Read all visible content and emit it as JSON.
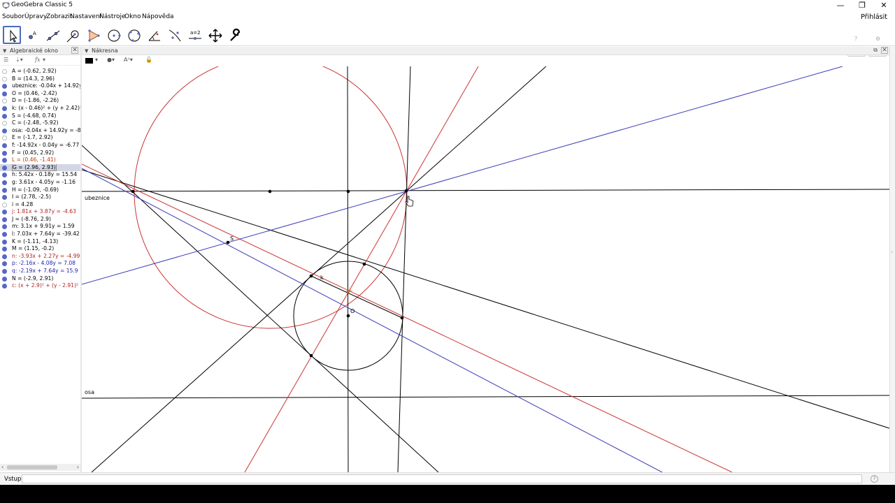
{
  "window": {
    "title": "GeoGebra Classic 5",
    "minimize": "—",
    "restore": "❐",
    "close": "✕"
  },
  "menu": [
    "Soubor",
    "Úpravy",
    "Zobrazit",
    "Nastavení",
    "Nástroje",
    "Okno",
    "Nápověda"
  ],
  "login": "Přihlásit",
  "toolbar": {
    "tools": [
      "move-tool",
      "point-tool",
      "line-tool",
      "perpendicular-tool",
      "polygon-tool",
      "circle-tool",
      "ellipse-tool",
      "angle-tool",
      "reflect-tool",
      "slider-tool",
      "move-graphics-tool",
      "settings-tool"
    ],
    "slider_text": "a=2",
    "undo": "↶",
    "redo": "↷",
    "help": "?",
    "settings": "⚙"
  },
  "algebra": {
    "title": "Algebraické okno",
    "close": "✕",
    "fx": "fx",
    "items": [
      {
        "text": "A = (-0.62, 2.92)",
        "visible": false,
        "color": "#000000"
      },
      {
        "text": "B = (14.3, 2.96)",
        "visible": false,
        "color": "#000000"
      },
      {
        "text": "ubeznice: -0.04x + 14.92y",
        "visible": true,
        "color": "#000000"
      },
      {
        "text": "O = (0.46, -2.42)",
        "visible": true,
        "color": "#000000"
      },
      {
        "text": "D = (-1.86, -2.26)",
        "visible": false,
        "color": "#000000"
      },
      {
        "text": "k: (x - 0.46)² + (y + 2.42)² =",
        "visible": true,
        "color": "#000000"
      },
      {
        "text": "S = (-4.68, 0.74)",
        "visible": true,
        "color": "#000000"
      },
      {
        "text": "C = (-2.48, -5.92)",
        "visible": false,
        "color": "#000000"
      },
      {
        "text": "osa: -0.04x + 14.92y = -88.",
        "visible": true,
        "color": "#000000"
      },
      {
        "text": "E = (-1.7, 2.92)",
        "visible": false,
        "color": "#000000"
      },
      {
        "text": "f: -14.92x - 0.04y = -6.77",
        "visible": true,
        "color": "#000000"
      },
      {
        "text": "F = (0.45, 2.92)",
        "visible": true,
        "color": "#000000"
      },
      {
        "text": "L = (0.46, -1.41)",
        "visible": true,
        "color": "#cc3300"
      },
      {
        "text": "G = (2.96, 2.93)",
        "visible": true,
        "color": "#000000",
        "selected": true
      },
      {
        "text": "h: 5.42x - 0.18y = 15.54",
        "visible": true,
        "color": "#000000"
      },
      {
        "text": "g: 3.61x - 4.05y = -1.16",
        "visible": true,
        "color": "#000000"
      },
      {
        "text": "H = (-1.09, -0.69)",
        "visible": true,
        "color": "#000000"
      },
      {
        "text": "I = (2.78, -2.5)",
        "visible": true,
        "color": "#000000"
      },
      {
        "text": "i = 4.28",
        "visible": false,
        "color": "#000000"
      },
      {
        "text": "j: 1.81x + 3.87y = -4.63",
        "visible": true,
        "color": "#b22222"
      },
      {
        "text": "J = (-8.76, 2.9)",
        "visible": true,
        "color": "#000000"
      },
      {
        "text": "m: 3.1x + 9.91y = 1.59",
        "visible": true,
        "color": "#000000"
      },
      {
        "text": "l: 7.03x + 7.64y = -39.42",
        "visible": true,
        "color": "#000000"
      },
      {
        "text": "K = (-1.11, -4.13)",
        "visible": true,
        "color": "#000000"
      },
      {
        "text": "M = (1.15, -0.2)",
        "visible": true,
        "color": "#000000"
      },
      {
        "text": "n: -3.93x + 2.27y = -4.99",
        "visible": true,
        "color": "#b22222"
      },
      {
        "text": "p: -2.16x - 4.08y = 7.08",
        "visible": true,
        "color": "#2222aa"
      },
      {
        "text": "q: -2.19x + 7.64y = 15.9",
        "visible": true,
        "color": "#2222aa"
      },
      {
        "text": "N = (-2.9, 2.91)",
        "visible": true,
        "color": "#000000"
      },
      {
        "text": "c: (x + 2.9)² + (y - 2.91)² = 3",
        "visible": true,
        "color": "#b22222"
      }
    ]
  },
  "graphics": {
    "title": "Nákresna",
    "labels": {
      "ubeznice": "ubeznice",
      "osa": "osa",
      "S": "S",
      "k": "k",
      "L": "L",
      "O": "O"
    },
    "colors": {
      "red": "#cc3333",
      "blue": "#3a3ab8",
      "black": "#000000"
    }
  },
  "input": {
    "label": "Vstup:",
    "value": "",
    "help": "?"
  }
}
